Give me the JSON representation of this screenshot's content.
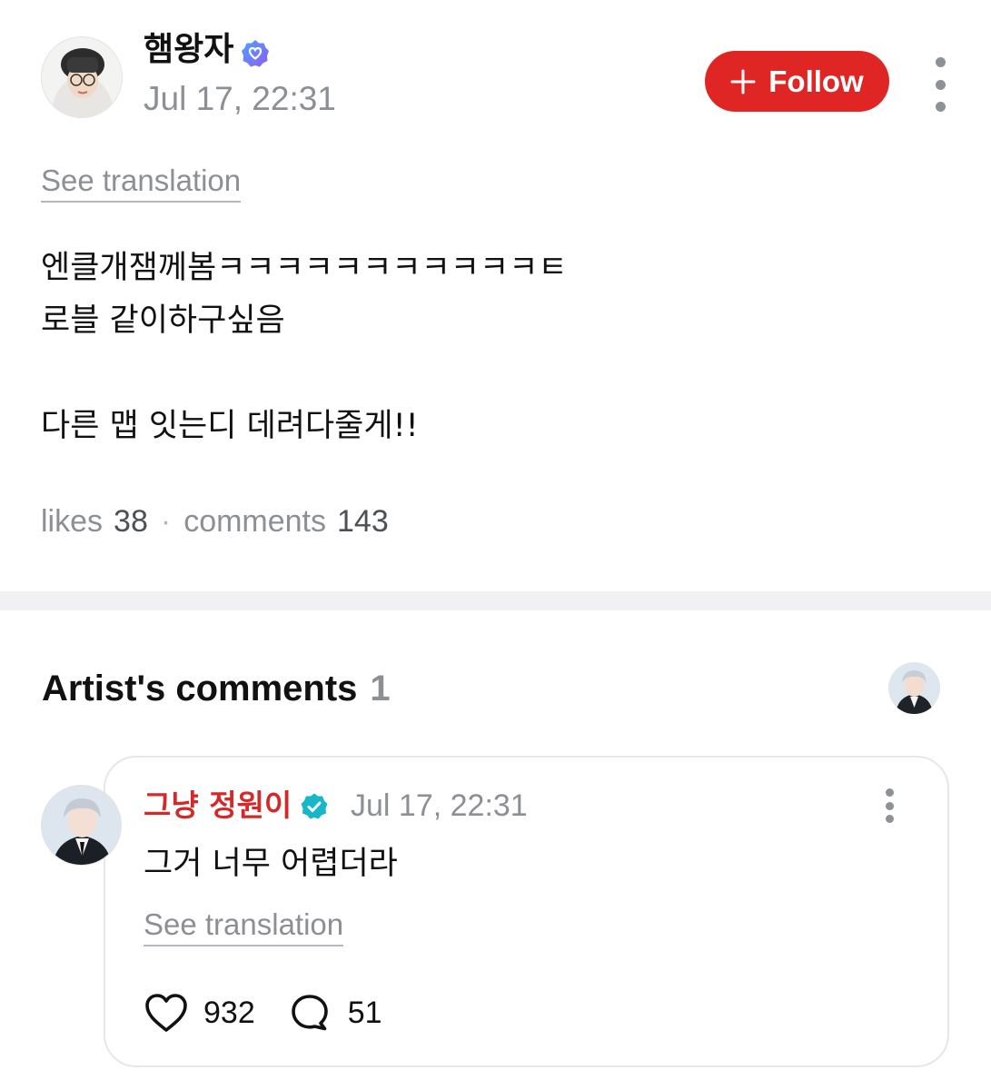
{
  "post": {
    "author_name": "햄왕자",
    "date": "Jul 17, 22:31",
    "follow_label": "Follow",
    "translate_label": "See translation",
    "body": "엔클개잼께봄ㅋㅋㅋㅋㅋㅋㅋㅋㅋㅋㅋㅌ\n로블 같이하구싶음\n\n다른 맵 잇는디 데려다줄게!!",
    "stats": {
      "likes_label": "likes",
      "likes_count": "38",
      "separator": "·",
      "comments_label": "comments",
      "comments_count": "143"
    }
  },
  "artist_comments": {
    "title": "Artist's comments",
    "count": "1",
    "comments": [
      {
        "author_name": "그냥 정원이",
        "date": "Jul 17, 22:31",
        "text": "그거 너무 어렵더라",
        "translate_label": "See translation",
        "like_count": "932",
        "reply_count": "51"
      }
    ]
  },
  "colors": {
    "follow_button": "#e02525",
    "artist_name": "#d62828",
    "fan_badge": "#7b5cf0",
    "artist_badge": "#18b6c9",
    "muted_text": "#8c8f94"
  },
  "icons": {
    "author_badge": "verified-fan-badge-icon",
    "artist_badge": "verified-artist-badge-icon",
    "follow": "plus-icon",
    "more": "more-vertical-icon",
    "like": "heart-icon",
    "reply": "speech-bubble-icon"
  }
}
